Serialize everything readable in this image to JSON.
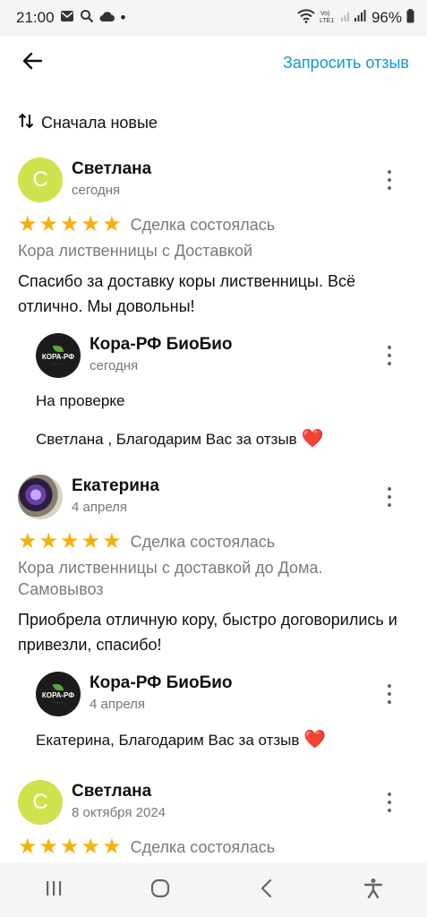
{
  "status_bar": {
    "time": "21:00",
    "dot": "•",
    "battery_text": "96%",
    "left_icons": [
      "mail-icon",
      "search-icon",
      "cloud-icon"
    ],
    "right_icons": [
      "wifi-icon",
      "volte-icon",
      "signal-icon",
      "battery-icon"
    ]
  },
  "app_bar": {
    "back_icon": "arrow-left-icon",
    "request_label": "Запросить отзыв",
    "accent_color": "#0a9ad6"
  },
  "sort": {
    "icon": "sort-arrows-icon",
    "label": "Сначала новые"
  },
  "colors": {
    "star": "#f5b10a",
    "avatar_green": "#cfe24e",
    "heart": "#ee3b5f"
  },
  "reviews": [
    {
      "avatar_letter": "С",
      "name": "Светлана",
      "date": "сегодня",
      "stars": 5,
      "deal": "Сделка состоялась",
      "item": "Кора лиственницы с Доставкой",
      "text": "Спасибо за доставку коры лиственницы. Всё отлично. Мы довольны!",
      "answer": {
        "logo_text": "КОРА-РФ",
        "name": "Кора-РФ БиоБио",
        "date": "сегодня",
        "status": "На проверке",
        "text": "Светлана , Благодарим Вас за отзыв",
        "heart": "❤️"
      }
    },
    {
      "name": "Екатерина",
      "date": "4 апреля",
      "stars": 5,
      "deal": "Сделка состоялась",
      "item": "Кора лиственницы с доставкой до Дома. Самовывоз",
      "text": "Приобрела отличную кору, быстро договорились и привезли, спасибо!",
      "answer": {
        "logo_text": "КОРА-РФ",
        "name": "Кора-РФ БиоБио",
        "date": "4 апреля",
        "text": "Екатерина,  Благодарим Вас за отзыв",
        "heart": "❤️"
      }
    },
    {
      "avatar_letter": "С",
      "name": "Светлана",
      "date": "8 октября 2024",
      "stars": 5,
      "deal": "Сделка состоялась"
    }
  ],
  "nav_bar": {
    "icons": [
      "recent-apps-icon",
      "home-icon",
      "back-icon",
      "accessibility-icon"
    ]
  }
}
